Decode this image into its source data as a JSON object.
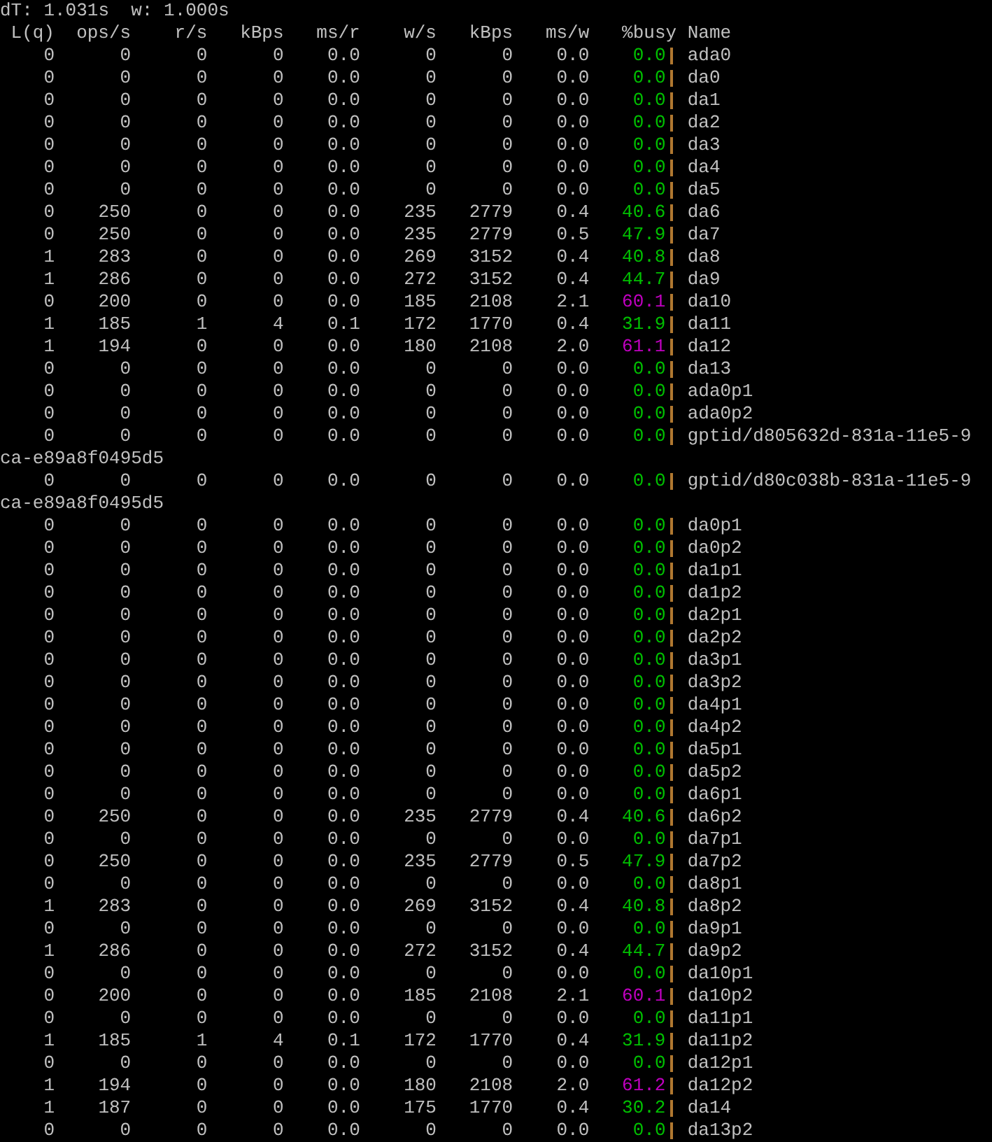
{
  "status_line": "dT: 1.031s  w: 1.000s",
  "columns": [
    "L(q)",
    "ops/s",
    "r/s",
    "kBps",
    "ms/r",
    "w/s",
    "kBps",
    "ms/w",
    "%busy",
    "Name"
  ],
  "rows": [
    {
      "cells": [
        "0",
        "0",
        "0",
        "0",
        "0.0",
        "0",
        "0",
        "0.0",
        "0.0"
      ],
      "color": "#00c000",
      "name": "ada0"
    },
    {
      "cells": [
        "0",
        "0",
        "0",
        "0",
        "0.0",
        "0",
        "0",
        "0.0",
        "0.0"
      ],
      "color": "#00c000",
      "name": "da0"
    },
    {
      "cells": [
        "0",
        "0",
        "0",
        "0",
        "0.0",
        "0",
        "0",
        "0.0",
        "0.0"
      ],
      "color": "#00c000",
      "name": "da1"
    },
    {
      "cells": [
        "0",
        "0",
        "0",
        "0",
        "0.0",
        "0",
        "0",
        "0.0",
        "0.0"
      ],
      "color": "#00c000",
      "name": "da2"
    },
    {
      "cells": [
        "0",
        "0",
        "0",
        "0",
        "0.0",
        "0",
        "0",
        "0.0",
        "0.0"
      ],
      "color": "#00c000",
      "name": "da3"
    },
    {
      "cells": [
        "0",
        "0",
        "0",
        "0",
        "0.0",
        "0",
        "0",
        "0.0",
        "0.0"
      ],
      "color": "#00c000",
      "name": "da4"
    },
    {
      "cells": [
        "0",
        "0",
        "0",
        "0",
        "0.0",
        "0",
        "0",
        "0.0",
        "0.0"
      ],
      "color": "#00c000",
      "name": "da5"
    },
    {
      "cells": [
        "0",
        "250",
        "0",
        "0",
        "0.0",
        "235",
        "2779",
        "0.4",
        "40.6"
      ],
      "color": "#00c000",
      "name": "da6"
    },
    {
      "cells": [
        "0",
        "250",
        "0",
        "0",
        "0.0",
        "235",
        "2779",
        "0.5",
        "47.9"
      ],
      "color": "#00c000",
      "name": "da7"
    },
    {
      "cells": [
        "1",
        "283",
        "0",
        "0",
        "0.0",
        "269",
        "3152",
        "0.4",
        "40.8"
      ],
      "color": "#00c000",
      "name": "da8"
    },
    {
      "cells": [
        "1",
        "286",
        "0",
        "0",
        "0.0",
        "272",
        "3152",
        "0.4",
        "44.7"
      ],
      "color": "#00c000",
      "name": "da9"
    },
    {
      "cells": [
        "0",
        "200",
        "0",
        "0",
        "0.0",
        "185",
        "2108",
        "2.1",
        "60.1"
      ],
      "color": "#c000c0",
      "name": "da10"
    },
    {
      "cells": [
        "1",
        "185",
        "1",
        "4",
        "0.1",
        "172",
        "1770",
        "0.4",
        "31.9"
      ],
      "color": "#00c000",
      "name": "da11"
    },
    {
      "cells": [
        "1",
        "194",
        "0",
        "0",
        "0.0",
        "180",
        "2108",
        "2.0",
        "61.1"
      ],
      "color": "#c000c0",
      "name": "da12"
    },
    {
      "cells": [
        "0",
        "0",
        "0",
        "0",
        "0.0",
        "0",
        "0",
        "0.0",
        "0.0"
      ],
      "color": "#00c000",
      "name": "da13"
    },
    {
      "cells": [
        "0",
        "0",
        "0",
        "0",
        "0.0",
        "0",
        "0",
        "0.0",
        "0.0"
      ],
      "color": "#00c000",
      "name": "ada0p1"
    },
    {
      "cells": [
        "0",
        "0",
        "0",
        "0",
        "0.0",
        "0",
        "0",
        "0.0",
        "0.0"
      ],
      "color": "#00c000",
      "name": "ada0p2"
    },
    {
      "cells": [
        "0",
        "0",
        "0",
        "0",
        "0.0",
        "0",
        "0",
        "0.0",
        "0.0"
      ],
      "color": "#00c000",
      "name": "gptid/d805632d-831a-11e5-9",
      "continued": "ca-e89a8f0495d5"
    },
    {
      "cells": [
        "0",
        "0",
        "0",
        "0",
        "0.0",
        "0",
        "0",
        "0.0",
        "0.0"
      ],
      "color": "#00c000",
      "name": "gptid/d80c038b-831a-11e5-9",
      "continued": "ca-e89a8f0495d5"
    },
    {
      "cells": [
        "0",
        "0",
        "0",
        "0",
        "0.0",
        "0",
        "0",
        "0.0",
        "0.0"
      ],
      "color": "#00c000",
      "name": "da0p1"
    },
    {
      "cells": [
        "0",
        "0",
        "0",
        "0",
        "0.0",
        "0",
        "0",
        "0.0",
        "0.0"
      ],
      "color": "#00c000",
      "name": "da0p2"
    },
    {
      "cells": [
        "0",
        "0",
        "0",
        "0",
        "0.0",
        "0",
        "0",
        "0.0",
        "0.0"
      ],
      "color": "#00c000",
      "name": "da1p1"
    },
    {
      "cells": [
        "0",
        "0",
        "0",
        "0",
        "0.0",
        "0",
        "0",
        "0.0",
        "0.0"
      ],
      "color": "#00c000",
      "name": "da1p2"
    },
    {
      "cells": [
        "0",
        "0",
        "0",
        "0",
        "0.0",
        "0",
        "0",
        "0.0",
        "0.0"
      ],
      "color": "#00c000",
      "name": "da2p1"
    },
    {
      "cells": [
        "0",
        "0",
        "0",
        "0",
        "0.0",
        "0",
        "0",
        "0.0",
        "0.0"
      ],
      "color": "#00c000",
      "name": "da2p2"
    },
    {
      "cells": [
        "0",
        "0",
        "0",
        "0",
        "0.0",
        "0",
        "0",
        "0.0",
        "0.0"
      ],
      "color": "#00c000",
      "name": "da3p1"
    },
    {
      "cells": [
        "0",
        "0",
        "0",
        "0",
        "0.0",
        "0",
        "0",
        "0.0",
        "0.0"
      ],
      "color": "#00c000",
      "name": "da3p2"
    },
    {
      "cells": [
        "0",
        "0",
        "0",
        "0",
        "0.0",
        "0",
        "0",
        "0.0",
        "0.0"
      ],
      "color": "#00c000",
      "name": "da4p1"
    },
    {
      "cells": [
        "0",
        "0",
        "0",
        "0",
        "0.0",
        "0",
        "0",
        "0.0",
        "0.0"
      ],
      "color": "#00c000",
      "name": "da4p2"
    },
    {
      "cells": [
        "0",
        "0",
        "0",
        "0",
        "0.0",
        "0",
        "0",
        "0.0",
        "0.0"
      ],
      "color": "#00c000",
      "name": "da5p1"
    },
    {
      "cells": [
        "0",
        "0",
        "0",
        "0",
        "0.0",
        "0",
        "0",
        "0.0",
        "0.0"
      ],
      "color": "#00c000",
      "name": "da5p2"
    },
    {
      "cells": [
        "0",
        "0",
        "0",
        "0",
        "0.0",
        "0",
        "0",
        "0.0",
        "0.0"
      ],
      "color": "#00c000",
      "name": "da6p1"
    },
    {
      "cells": [
        "0",
        "250",
        "0",
        "0",
        "0.0",
        "235",
        "2779",
        "0.4",
        "40.6"
      ],
      "color": "#00c000",
      "name": "da6p2"
    },
    {
      "cells": [
        "0",
        "0",
        "0",
        "0",
        "0.0",
        "0",
        "0",
        "0.0",
        "0.0"
      ],
      "color": "#00c000",
      "name": "da7p1"
    },
    {
      "cells": [
        "0",
        "250",
        "0",
        "0",
        "0.0",
        "235",
        "2779",
        "0.5",
        "47.9"
      ],
      "color": "#00c000",
      "name": "da7p2"
    },
    {
      "cells": [
        "0",
        "0",
        "0",
        "0",
        "0.0",
        "0",
        "0",
        "0.0",
        "0.0"
      ],
      "color": "#00c000",
      "name": "da8p1"
    },
    {
      "cells": [
        "1",
        "283",
        "0",
        "0",
        "0.0",
        "269",
        "3152",
        "0.4",
        "40.8"
      ],
      "color": "#00c000",
      "name": "da8p2"
    },
    {
      "cells": [
        "0",
        "0",
        "0",
        "0",
        "0.0",
        "0",
        "0",
        "0.0",
        "0.0"
      ],
      "color": "#00c000",
      "name": "da9p1"
    },
    {
      "cells": [
        "1",
        "286",
        "0",
        "0",
        "0.0",
        "272",
        "3152",
        "0.4",
        "44.7"
      ],
      "color": "#00c000",
      "name": "da9p2"
    },
    {
      "cells": [
        "0",
        "0",
        "0",
        "0",
        "0.0",
        "0",
        "0",
        "0.0",
        "0.0"
      ],
      "color": "#00c000",
      "name": "da10p1"
    },
    {
      "cells": [
        "0",
        "200",
        "0",
        "0",
        "0.0",
        "185",
        "2108",
        "2.1",
        "60.1"
      ],
      "color": "#c000c0",
      "name": "da10p2"
    },
    {
      "cells": [
        "0",
        "0",
        "0",
        "0",
        "0.0",
        "0",
        "0",
        "0.0",
        "0.0"
      ],
      "color": "#00c000",
      "name": "da11p1"
    },
    {
      "cells": [
        "1",
        "185",
        "1",
        "4",
        "0.1",
        "172",
        "1770",
        "0.4",
        "31.9"
      ],
      "color": "#00c000",
      "name": "da11p2"
    },
    {
      "cells": [
        "0",
        "0",
        "0",
        "0",
        "0.0",
        "0",
        "0",
        "0.0",
        "0.0"
      ],
      "color": "#00c000",
      "name": "da12p1"
    },
    {
      "cells": [
        "1",
        "194",
        "0",
        "0",
        "0.0",
        "180",
        "2108",
        "2.0",
        "61.2"
      ],
      "color": "#c000c0",
      "name": "da12p2"
    },
    {
      "cells": [
        "1",
        "187",
        "0",
        "0",
        "0.0",
        "175",
        "1770",
        "0.4",
        "30.2"
      ],
      "color": "#00c000",
      "name": "da14"
    },
    {
      "cells": [
        "0",
        "0",
        "0",
        "0",
        "0.0",
        "0",
        "0",
        "0.0",
        "0.0"
      ],
      "color": "#00c000",
      "name": "da13p2"
    }
  ]
}
